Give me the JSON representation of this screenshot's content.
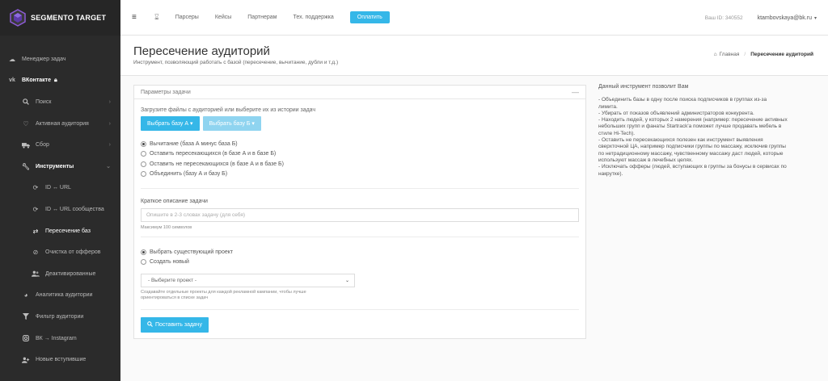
{
  "brand": {
    "name": "SEGMENTO TARGET",
    "accent": "#35b7e8",
    "sidebar_bg": "#2b2b2b"
  },
  "sidebar": {
    "items": [
      {
        "label": "Менеджер задач",
        "icon": "cloud-icon"
      },
      {
        "label": "ВКонтакте",
        "icon": "vk-icon",
        "lock_icon": "lock-icon"
      },
      {
        "label": "Поиск",
        "icon": "search-icon",
        "chevron": "›"
      },
      {
        "label": "Активная аудитория",
        "icon": "heart-icon",
        "chevron": "›"
      },
      {
        "label": "Сбор",
        "icon": "truck-icon",
        "chevron": "›"
      },
      {
        "label": "Инструменты",
        "icon": "wrench-icon",
        "chevron": "⌄"
      },
      {
        "label": "ID ↔ URL",
        "icon": "refresh-icon"
      },
      {
        "label": "ID ↔ URL сообщества",
        "icon": "refresh-icon"
      },
      {
        "label": "Пересечение баз",
        "icon": "shuffle-icon"
      },
      {
        "label": "Очистка от офферов",
        "icon": "ban-icon"
      },
      {
        "label": "Деактивированные",
        "icon": "users-icon"
      },
      {
        "label": "Аналитика аудитории",
        "icon": "chart-icon"
      },
      {
        "label": "Фильтр аудитории",
        "icon": "filter-icon"
      },
      {
        "label": "ВК → Instagram",
        "icon": "instagram-icon"
      },
      {
        "label": "Новые вступившие",
        "icon": "user-plus-icon"
      }
    ]
  },
  "topbar": {
    "menu": [
      "Парсеры",
      "Кейсы",
      "Партнерам",
      "Тех. поддержка"
    ],
    "pay_label": "Оплатить",
    "base_id": "Ваш ID: 340552",
    "user_email": "ktambovskaya@bk.ru"
  },
  "header": {
    "title": "Пересечение аудиторий",
    "subtitle": "Инструмент, позволяющий работать с базой (пересечение, вычитание, дубли и т.д.)",
    "breadcrumb_home": "Главная",
    "breadcrumb_current": "Пересечение аудиторий"
  },
  "task": {
    "panel_title": "Параметры задачи",
    "collapse_symbol": "—",
    "upload_hint": "Загрузите файлы с аудиторией или выберите их из истории задач",
    "btn_a": "Выбрать базу А ▾",
    "btn_b": "Выбрать базу Б ▾",
    "modes": [
      {
        "label": "Вычитание (база А минус база Б)",
        "checked": true
      },
      {
        "label": "Оставить пересекающихся (в базе А и в базе Б)",
        "checked": false
      },
      {
        "label": "Оставить не пересекающихся (в базе А и в базе Б)",
        "checked": false
      },
      {
        "label": "Объединить (базу А и базу Б)",
        "checked": false
      }
    ],
    "desc_label": "Краткое описание задачи",
    "desc_placeholder": "Опишите в 2-3 словах задачу (для себя)",
    "desc_note": "Максимум 100 символов",
    "project_modes": [
      {
        "label": "Выбрать существующий проект",
        "checked": true
      },
      {
        "label": "Создать новый",
        "checked": false
      }
    ],
    "project_select": "- Выберите проект -",
    "project_note_1": "Создавайте отдельные проекты для каждой рекламной кампании, чтобы лучше",
    "project_note_2": "ориентироваться в списке задач",
    "submit_label": "Поставить задачу"
  },
  "info": {
    "title": "Данный инструмент позволит Вам",
    "lines": [
      "- Объединить базы в одну после поиска подписчиков в группах из-за",
      "лимита.",
      "- Убирать от показов объявлений администраторов конкурента.",
      "- Находить людей, у которых 2 намерения (например: пересечение активных",
      "небольших групп и фанаты Startrack'а поможет лучше продавать мебель в",
      "стиле Hi-Tech).",
      "- Оставить не пересекающихся полезен как инструмент выявления",
      "сверхточной ЦА, например подписчики группы по массажу, исключив группы",
      "по нетрадиционному массажу, чувственному массажу даст людей, которые",
      "используют массаж в лечебных целях.",
      "- Исключать офферы (людей, вступающих в группы за бонусы в сервисах по",
      "накрутке)."
    ]
  }
}
